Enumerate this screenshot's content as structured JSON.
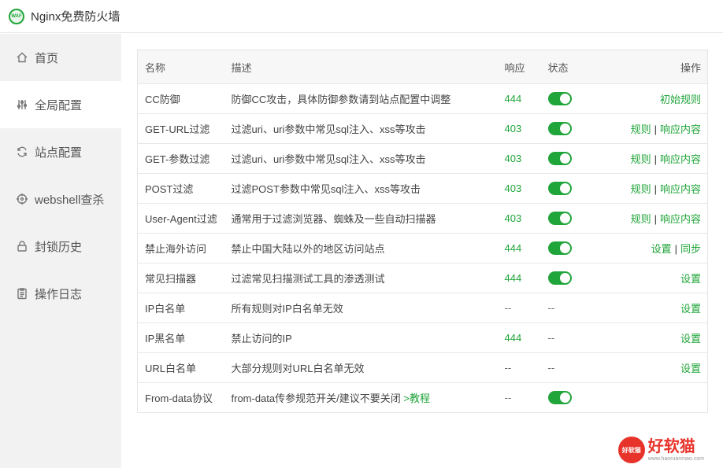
{
  "window": {
    "title": "Nginx免费防火墙",
    "logo_text": "WAF"
  },
  "sidebar": {
    "items": [
      {
        "label": "首页",
        "icon": "home-icon"
      },
      {
        "label": "全局配置",
        "icon": "sliders-icon"
      },
      {
        "label": "站点配置",
        "icon": "refresh-icon"
      },
      {
        "label": "webshell查杀",
        "icon": "target-icon"
      },
      {
        "label": "封锁历史",
        "icon": "lock-icon"
      },
      {
        "label": "操作日志",
        "icon": "clipboard-icon"
      }
    ],
    "active_index": 1
  },
  "table": {
    "headers": {
      "name": "名称",
      "desc": "描述",
      "resp": "响应",
      "state": "状态",
      "ops": "操作"
    },
    "rows": [
      {
        "name": "CC防御",
        "desc": "防御CC攻击，具体防御参数请到站点配置中调整",
        "resp": "444",
        "state": "on",
        "ops": [
          "初始规则"
        ]
      },
      {
        "name": "GET-URL过滤",
        "desc": "过滤uri、uri参数中常见sql注入、xss等攻击",
        "resp": "403",
        "state": "on",
        "ops": [
          "规则",
          "响应内容"
        ]
      },
      {
        "name": "GET-参数过滤",
        "desc": "过滤uri、uri参数中常见sql注入、xss等攻击",
        "resp": "403",
        "state": "on",
        "ops": [
          "规则",
          "响应内容"
        ]
      },
      {
        "name": "POST过滤",
        "desc": "过滤POST参数中常见sql注入、xss等攻击",
        "resp": "403",
        "state": "on",
        "ops": [
          "规则",
          "响应内容"
        ]
      },
      {
        "name": "User-Agent过滤",
        "desc": "通常用于过滤浏览器、蜘蛛及一些自动扫描器",
        "resp": "403",
        "state": "on",
        "ops": [
          "规则",
          "响应内容"
        ]
      },
      {
        "name": "禁止海外访问",
        "desc": "禁止中国大陆以外的地区访问站点",
        "resp": "444",
        "state": "on",
        "ops": [
          "设置",
          "同步"
        ]
      },
      {
        "name": "常见扫描器",
        "desc": "过滤常见扫描测试工具的渗透测试",
        "resp": "444",
        "state": "on",
        "ops": [
          "设置"
        ]
      },
      {
        "name": "IP白名单",
        "desc": "所有规则对IP白名单无效",
        "resp": "--",
        "state": "--",
        "ops": [
          "设置"
        ]
      },
      {
        "name": "IP黑名单",
        "desc": "禁止访问的IP",
        "resp": "444",
        "state": "--",
        "ops": [
          "设置"
        ]
      },
      {
        "name": "URL白名单",
        "desc": "大部分规则对URL白名单无效",
        "resp": "--",
        "state": "--",
        "ops": [
          "设置"
        ]
      },
      {
        "name": "From-data协议",
        "desc": "from-data传参规范开关/建议不要关闭",
        "desc_link": ">教程",
        "resp": "--",
        "state": "on",
        "ops": []
      }
    ]
  },
  "watermark": {
    "badge": "好软猫",
    "text": "好软猫",
    "url": "www.haoruanmao.com"
  },
  "colors": {
    "accent": "#20a53a",
    "sidebar_bg": "#f2f2f2",
    "watermark": "#e8332b"
  }
}
